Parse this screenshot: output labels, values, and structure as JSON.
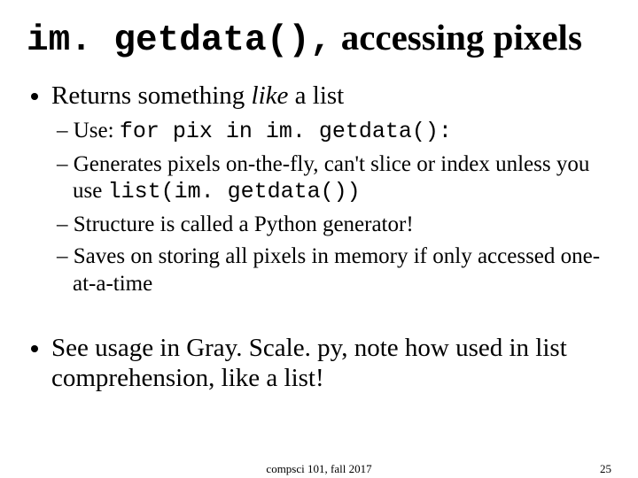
{
  "title": {
    "code": "im. getdata(),",
    "rest": " accessing pixels"
  },
  "bullets": {
    "b1": {
      "pre": "Returns something ",
      "italic": "like",
      "post": " a list"
    },
    "b1_subs": {
      "s1": {
        "pre": "Use: ",
        "code": "for pix in im. getdata():"
      },
      "s2": {
        "pre": "Generates pixels on-the-fly, can't slice or index unless you use ",
        "code": "list(im. getdata())"
      },
      "s3": {
        "text": "Structure is called a Python generator!"
      },
      "s4": {
        "text": "Saves on storing all pixels in memory if only accessed one-at-a-time"
      }
    },
    "b2": {
      "text": "See usage in Gray. Scale. py, note how used in list comprehension, like a list!"
    }
  },
  "footer": {
    "center": "compsci 101, fall 2017",
    "pagenum": "25"
  }
}
